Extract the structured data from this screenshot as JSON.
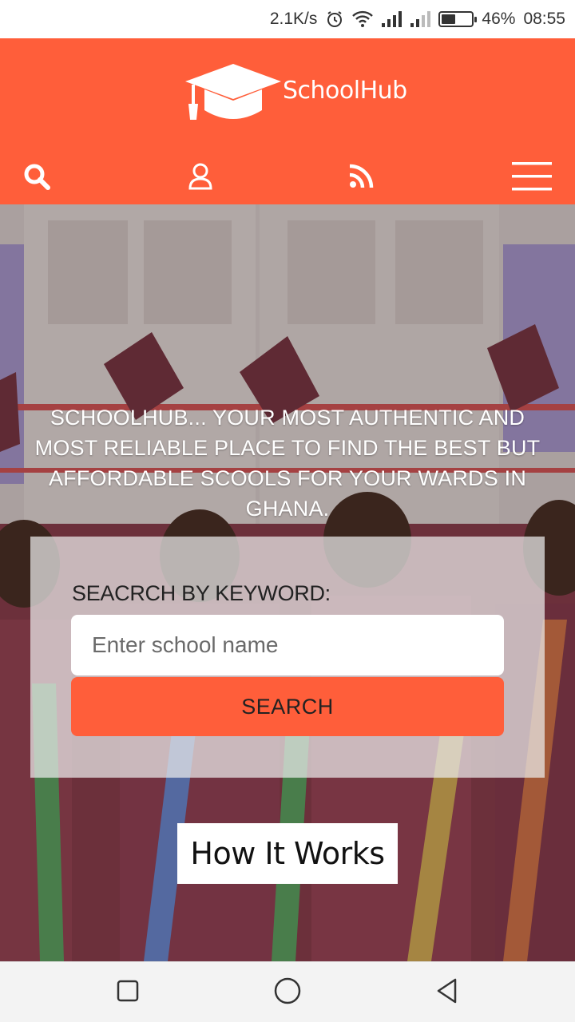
{
  "status_bar": {
    "speed": "2.1K/s",
    "battery": "46%",
    "battery_level": 0.46,
    "time": "08:55"
  },
  "header": {
    "logo_text": "SchoolHub",
    "brand_color": "#ff5e3a",
    "nav": [
      {
        "name": "search",
        "icon": "search-icon"
      },
      {
        "name": "account",
        "icon": "user-icon"
      },
      {
        "name": "feed",
        "icon": "rss-icon"
      },
      {
        "name": "menu",
        "icon": "hamburger-menu-icon"
      }
    ]
  },
  "hero": {
    "tagline": "SCHOOLHUB... YOUR MOST AUTHENTIC AND MOST RELIABLE PLACE TO FIND THE BEST BUT AFFORDABLE SCOOLS FOR YOUR WARDS IN GHANA.",
    "search": {
      "label": "SEACRCH BY KEYWORD:",
      "placeholder": "Enter school name",
      "button_label": "SEARCH"
    },
    "how_it_works": "How It Works"
  },
  "android_nav": [
    {
      "name": "recents",
      "icon": "square-icon"
    },
    {
      "name": "home",
      "icon": "circle-icon"
    },
    {
      "name": "back",
      "icon": "triangle-back-icon"
    }
  ]
}
